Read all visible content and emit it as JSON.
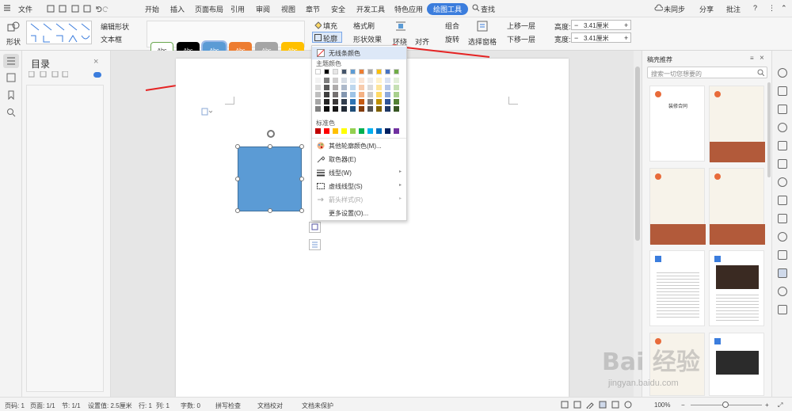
{
  "tabs": {
    "file": "文件",
    "home": "开始",
    "insert": "插入",
    "layout": "页面布局",
    "ref": "引用",
    "review": "审阅",
    "view": "视图",
    "chapter": "章节",
    "security": "安全",
    "dev": "开发工具",
    "special": "特色应用",
    "drawing": "绘图工具",
    "search": "查找"
  },
  "topright": {
    "sync": "未同步",
    "share": "分享",
    "note": "批注"
  },
  "ribbon": {
    "shape": "形状",
    "edit_shape": "编辑形状",
    "textbox": "文本框",
    "style_label": "Abc",
    "fill": "填充",
    "format_painter": "格式刷",
    "outline": "轮廓",
    "shape_effect": "形状效果",
    "wrap": "环绕",
    "align": "对齐",
    "group": "组合",
    "rotate": "旋转",
    "selection_pane": "选择窗格",
    "bring_forward": "上移一层",
    "send_backward": "下移一层",
    "height_label": "高度:",
    "width_label": "宽度:",
    "height_value": "3.41厘米",
    "width_value": "3.41厘米",
    "minus": "−",
    "plus": "+"
  },
  "styles": [
    {
      "bg": "#ffffff",
      "fg": "#333333",
      "border": "#6aa84f"
    },
    {
      "bg": "#000000",
      "fg": "#ffffff",
      "border": "#000000"
    },
    {
      "bg": "#5b9bd5",
      "fg": "#ffffff",
      "border": "#5b9bd5"
    },
    {
      "bg": "#ed7d31",
      "fg": "#ffffff",
      "border": "#ed7d31"
    },
    {
      "bg": "#a5a5a5",
      "fg": "#ffffff",
      "border": "#a5a5a5"
    },
    {
      "bg": "#ffc000",
      "fg": "#ffffff",
      "border": "#ffc000"
    }
  ],
  "toc": {
    "title": "目录"
  },
  "menu": {
    "no_line": "无线条颜色",
    "theme_colors": "主题颜色",
    "standard_colors": "标准色",
    "more_colors": "其他轮廓颜色(M)...",
    "eyedropper": "取色器(E)",
    "line_type": "线型(W)",
    "dash_type": "虚线线型(S)",
    "arrow_style": "箭头样式(R)",
    "more_settings": "更多设置(O)..."
  },
  "theme_top": [
    "#ffffff",
    "#000000",
    "#e7e6e6",
    "#44546a",
    "#5b9bd5",
    "#ed7d31",
    "#a5a5a5",
    "#ffc000",
    "#4472c4",
    "#70ad47"
  ],
  "theme_cols": [
    [
      "#f2f2f2",
      "#d9d9d9",
      "#bfbfbf",
      "#a6a6a6",
      "#808080"
    ],
    [
      "#7f7f7f",
      "#595959",
      "#404040",
      "#262626",
      "#0d0d0d"
    ],
    [
      "#d0cece",
      "#aeabab",
      "#757171",
      "#3b3838",
      "#171616"
    ],
    [
      "#d6dce4",
      "#adb9ca",
      "#8497b0",
      "#333f4f",
      "#222a35"
    ],
    [
      "#deebf6",
      "#bdd7ee",
      "#9dc3e6",
      "#2e75b5",
      "#1f4e79"
    ],
    [
      "#fbe5d5",
      "#f7cbac",
      "#f4b183",
      "#c55a11",
      "#833c0b"
    ],
    [
      "#ededed",
      "#dbdbdb",
      "#c9c9c9",
      "#7b7b7b",
      "#525252"
    ],
    [
      "#fff2cc",
      "#fee599",
      "#ffd965",
      "#bf9000",
      "#7f6000"
    ],
    [
      "#d9e2f3",
      "#b4c6e7",
      "#8eaadb",
      "#2f5496",
      "#1f3864"
    ],
    [
      "#e2efd9",
      "#c5e0b3",
      "#a8d08d",
      "#538135",
      "#375623"
    ]
  ],
  "standard": [
    "#c00000",
    "#ff0000",
    "#ffc000",
    "#ffff00",
    "#92d050",
    "#00b050",
    "#00b0f0",
    "#0070c0",
    "#002060",
    "#7030a0"
  ],
  "panel": {
    "title": "稿壳推荐",
    "search_placeholder": "搜索一切您想要的",
    "thumb1_title": "装修合同"
  },
  "status": {
    "page_no": "页码: 1",
    "pages": "页面: 1/1",
    "section": "节: 1/1",
    "setting": "设置值: 2.5厘米",
    "row": "行: 1",
    "col": "列: 1",
    "words": "字数: 0",
    "spell": "拼写检查",
    "proof": "文档校对",
    "protect": "文档未保护",
    "zoom": "100%"
  },
  "watermark": {
    "text": "Bai 经验",
    "url": "jingyan.baidu.com"
  }
}
